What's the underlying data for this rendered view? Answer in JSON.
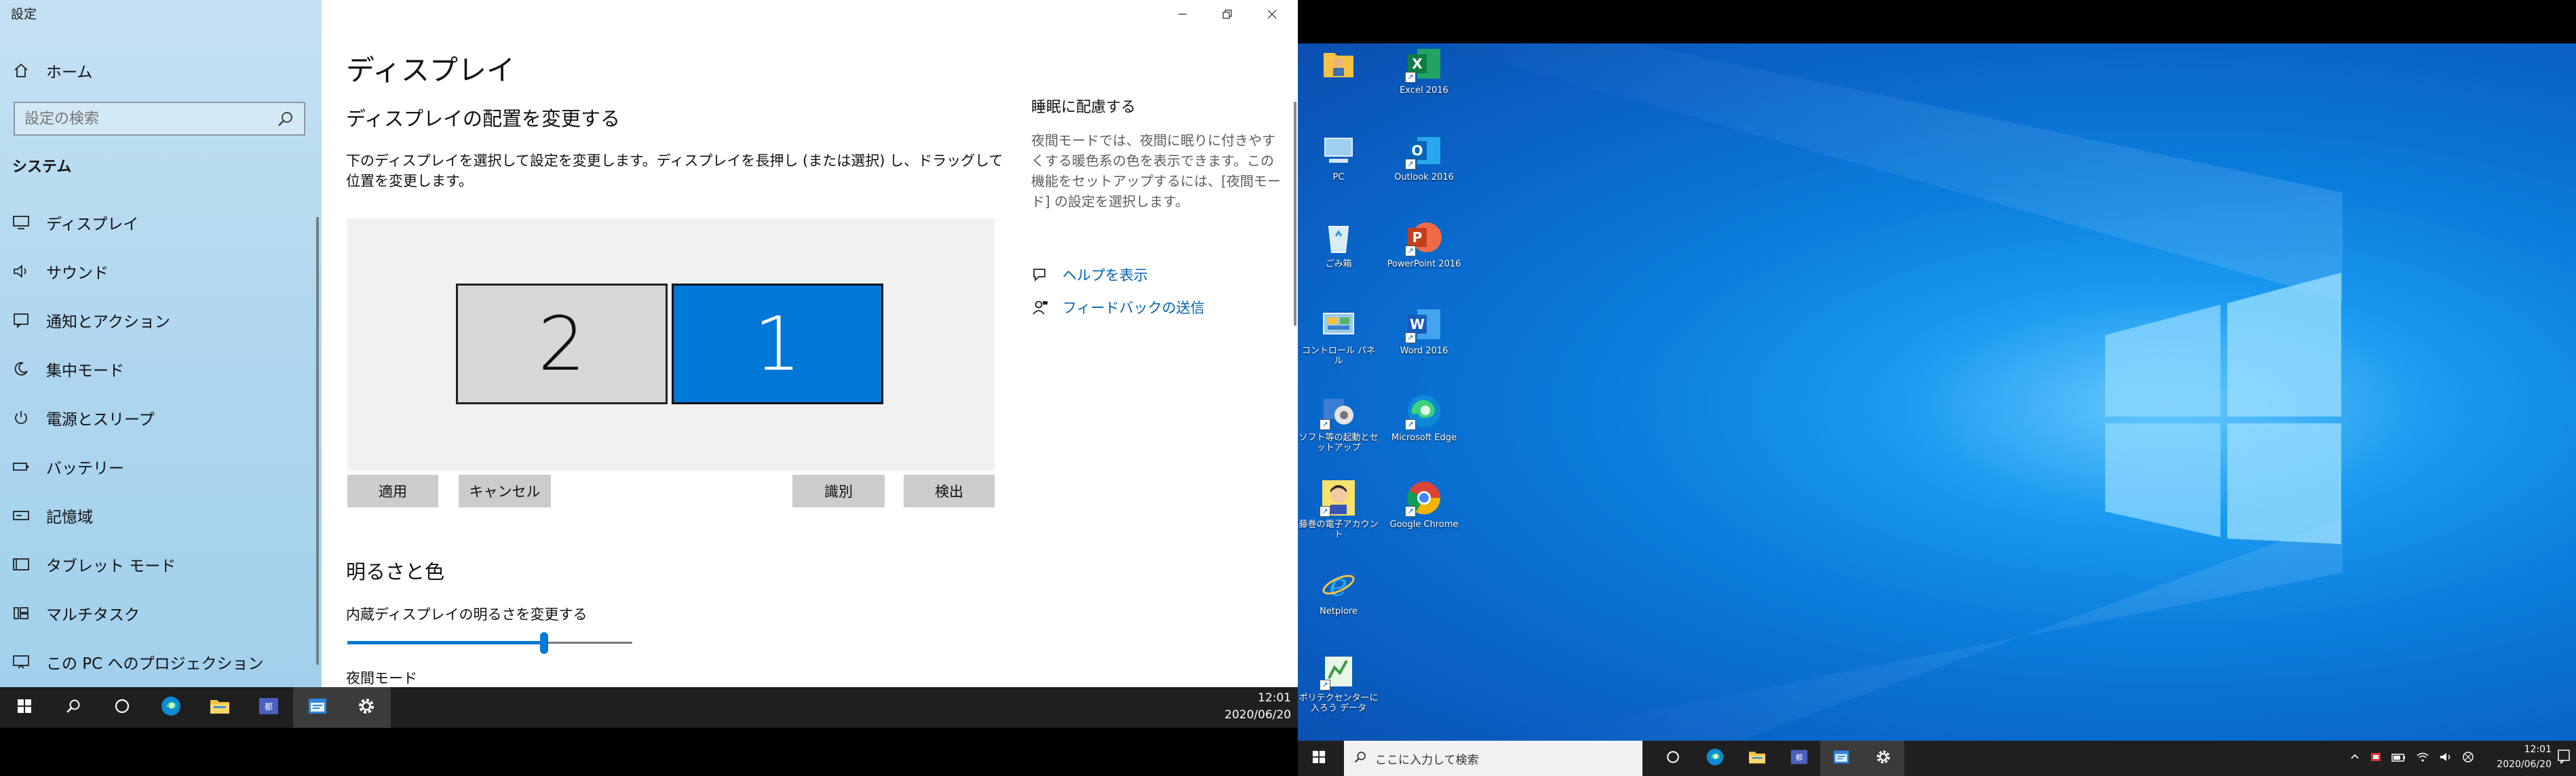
{
  "settings": {
    "app_title": "設定",
    "home_label": "ホーム",
    "search_placeholder": "設定の検索",
    "section_header": "システム",
    "nav_items": [
      {
        "label": "ディスプレイ",
        "icon": "monitor-icon"
      },
      {
        "label": "サウンド",
        "icon": "speaker-icon"
      },
      {
        "label": "通知とアクション",
        "icon": "notification-icon"
      },
      {
        "label": "集中モード",
        "icon": "moon-icon"
      },
      {
        "label": "電源とスリープ",
        "icon": "power-icon"
      },
      {
        "label": "バッテリー",
        "icon": "battery-icon"
      },
      {
        "label": "記憶域",
        "icon": "storage-icon"
      },
      {
        "label": "タブレット モード",
        "icon": "tablet-icon"
      },
      {
        "label": "マルチタスク",
        "icon": "multitask-icon"
      },
      {
        "label": "この PC へのプロジェクション",
        "icon": "projection-icon"
      }
    ],
    "page_title": "ディスプレイ",
    "arrange_heading": "ディスプレイの配置を変更する",
    "arrange_desc": "下のディスプレイを選択して設定を変更します。ディスプレイを長押し (または選択) し、ドラッグして位置を変更します。",
    "displays": [
      {
        "number": "2",
        "selected": false
      },
      {
        "number": "1",
        "selected": true
      }
    ],
    "buttons": {
      "apply": "適用",
      "cancel": "キャンセル",
      "identify": "識別",
      "detect": "検出"
    },
    "brightness_heading": "明るさと色",
    "brightness_label": "内蔵ディスプレイの明るさを変更する",
    "brightness_value": 0.69,
    "night_mode_label": "夜間モード",
    "right_panel": {
      "heading": "睡眠に配慮する",
      "text": "夜間モードでは、夜間に眠りに付きやすくする暖色系の色を表示できます。この機能をセットアップするには、[夜間モード] の設定を選択します。",
      "help_link": "ヘルプを表示",
      "feedback_link": "フィードバックの送信"
    },
    "accent_color": "#0078d7"
  },
  "taskbar_left": {
    "time": "12:01",
    "date": "2020/06/20",
    "items": [
      "windows-start-icon",
      "search-icon",
      "cortana-icon",
      "edge-icon",
      "file-explorer-icon",
      "app-icon",
      "window-icon",
      "settings-gear-icon"
    ]
  },
  "desktop": {
    "icons": [
      {
        "label": "",
        "icon": "user-folder-icon"
      },
      {
        "label": "Excel 2016",
        "icon": "excel-icon"
      },
      {
        "label": "PC",
        "icon": "pc-icon"
      },
      {
        "label": "Outlook 2016",
        "icon": "outlook-icon"
      },
      {
        "label": "ごみ箱",
        "icon": "recycle-bin-icon"
      },
      {
        "label": "PowerPoint 2016",
        "icon": "powerpoint-icon"
      },
      {
        "label": "コントロール パネル",
        "icon": "control-panel-icon"
      },
      {
        "label": "Word 2016",
        "icon": "word-icon"
      },
      {
        "label": "ソフト等の起動とセットアップ",
        "icon": "setup-icon"
      },
      {
        "label": "Microsoft Edge",
        "icon": "edge-icon"
      },
      {
        "label": "藤巻の電子アカウント",
        "icon": "avatar-icon"
      },
      {
        "label": "Google Chrome",
        "icon": "chrome-icon"
      },
      {
        "label": "Netplore",
        "icon": "ie-icon"
      },
      {
        "label": "ポリテクセンターに入ろう データ",
        "icon": "data-icon"
      }
    ]
  },
  "taskbar_right": {
    "search_placeholder": "ここに入力して検索",
    "time": "12:01",
    "date": "2020/06/20"
  }
}
